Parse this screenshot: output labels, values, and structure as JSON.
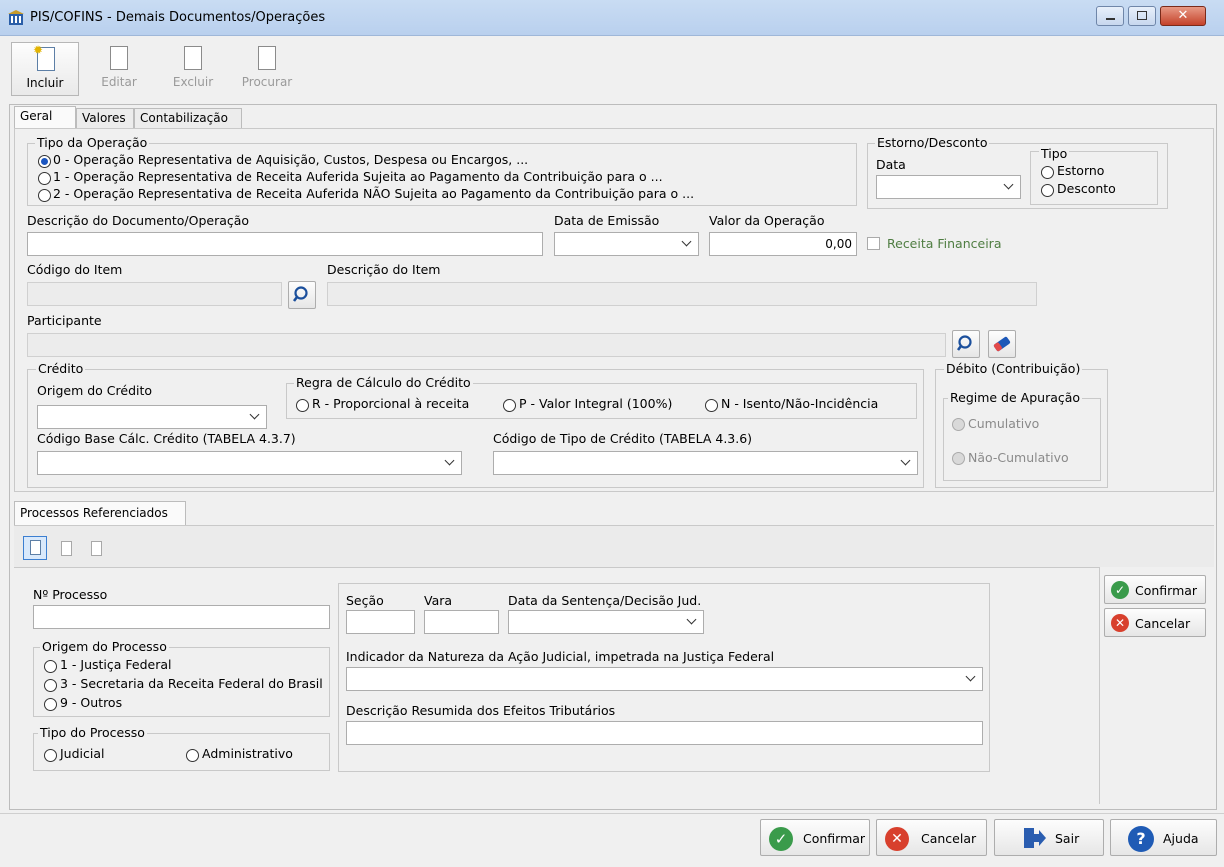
{
  "window": {
    "title": "PIS/COFINS - Demais Documentos/Operações"
  },
  "toolbar": {
    "incluir": "Incluir",
    "editar": "Editar",
    "excluir": "Excluir",
    "procurar": "Procurar"
  },
  "tabs": [
    "Geral",
    "Valores",
    "Contabilização"
  ],
  "tipo_operacao": {
    "legend": "Tipo da Operação",
    "options": [
      "0 - Operação Representativa de Aquisição, Custos, Despesa ou Encargos, ...",
      "1 - Operação Representativa de Receita Auferida Sujeita ao Pagamento da Contribuição para o ...",
      "2 - Operação Representativa de Receita Auferida NÃO Sujeita ao Pagamento da Contribuição para o ..."
    ],
    "selected": 0
  },
  "estorno": {
    "legend": "Estorno/Desconto",
    "data_label": "Data",
    "tipo_legend": "Tipo",
    "estorno": "Estorno",
    "desconto": "Desconto"
  },
  "descricao_label": "Descrição do Documento/Operação",
  "data_emissao_label": "Data de Emissão",
  "valor_label": "Valor da Operação",
  "valor_value": "0,00",
  "receita_financeira": "Receita Financeira",
  "codigo_item_label": "Código do Item",
  "descricao_item_label": "Descrição do Item",
  "participante_label": "Participante",
  "credito": {
    "legend": "Crédito",
    "origem_label": "Origem do Crédito",
    "regra_legend": "Regra de Cálculo do Crédito",
    "regra_options": [
      "R - Proporcional à receita",
      "P - Valor Integral (100%)",
      "N - Isento/Não-Incidência"
    ],
    "base_label": "Código Base Cálc. Crédito (TABELA 4.3.7)",
    "tipo_label": "Código de Tipo de Crédito (TABELA 4.3.6)"
  },
  "debito": {
    "legend": "Débito (Contribuição)",
    "regime_legend": "Regime de Apuração",
    "cumulativo": "Cumulativo",
    "nao_cumulativo": "Não-Cumulativo"
  },
  "processos_tab": "Processos Referenciados",
  "processo": {
    "numero_label": "Nº Processo",
    "origem_legend": "Origem do Processo",
    "origem_options": [
      "1 - Justiça Federal",
      "3 - Secretaria da Receita Federal do Brasil",
      "9 - Outros"
    ],
    "tipo_legend": "Tipo do Processo",
    "judicial": "Judicial",
    "administrativo": "Administrativo",
    "secao_label": "Seção",
    "vara_label": "Vara",
    "data_sentenca_label": "Data da Sentença/Decisão Jud.",
    "indicador_label": "Indicador da Natureza da Ação Judicial, impetrada na Justiça Federal",
    "efeitos_label": "Descrição Resumida dos Efeitos Tributários",
    "confirmar": "Confirmar",
    "cancelar": "Cancelar"
  },
  "footer": {
    "confirmar": "Confirmar",
    "cancelar": "Cancelar",
    "sair": "Sair",
    "ajuda": "Ajuda"
  }
}
